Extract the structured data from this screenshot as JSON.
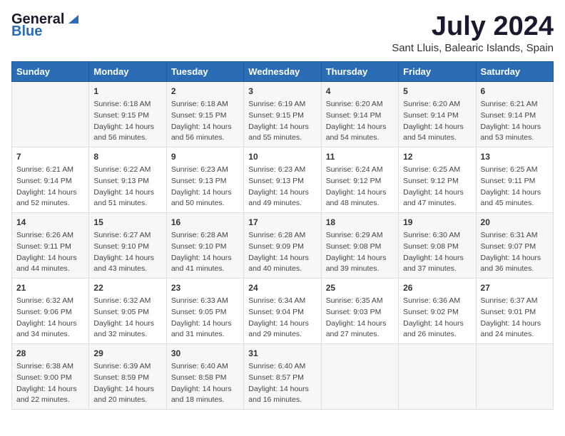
{
  "logo": {
    "general": "General",
    "blue": "Blue"
  },
  "title": "July 2024",
  "subtitle": "Sant Lluis, Balearic Islands, Spain",
  "headers": [
    "Sunday",
    "Monday",
    "Tuesday",
    "Wednesday",
    "Thursday",
    "Friday",
    "Saturday"
  ],
  "weeks": [
    [
      {
        "day": "",
        "content": ""
      },
      {
        "day": "1",
        "content": "Sunrise: 6:18 AM\nSunset: 9:15 PM\nDaylight: 14 hours\nand 56 minutes."
      },
      {
        "day": "2",
        "content": "Sunrise: 6:18 AM\nSunset: 9:15 PM\nDaylight: 14 hours\nand 56 minutes."
      },
      {
        "day": "3",
        "content": "Sunrise: 6:19 AM\nSunset: 9:15 PM\nDaylight: 14 hours\nand 55 minutes."
      },
      {
        "day": "4",
        "content": "Sunrise: 6:20 AM\nSunset: 9:14 PM\nDaylight: 14 hours\nand 54 minutes."
      },
      {
        "day": "5",
        "content": "Sunrise: 6:20 AM\nSunset: 9:14 PM\nDaylight: 14 hours\nand 54 minutes."
      },
      {
        "day": "6",
        "content": "Sunrise: 6:21 AM\nSunset: 9:14 PM\nDaylight: 14 hours\nand 53 minutes."
      }
    ],
    [
      {
        "day": "7",
        "content": "Sunrise: 6:21 AM\nSunset: 9:14 PM\nDaylight: 14 hours\nand 52 minutes."
      },
      {
        "day": "8",
        "content": "Sunrise: 6:22 AM\nSunset: 9:13 PM\nDaylight: 14 hours\nand 51 minutes."
      },
      {
        "day": "9",
        "content": "Sunrise: 6:23 AM\nSunset: 9:13 PM\nDaylight: 14 hours\nand 50 minutes."
      },
      {
        "day": "10",
        "content": "Sunrise: 6:23 AM\nSunset: 9:13 PM\nDaylight: 14 hours\nand 49 minutes."
      },
      {
        "day": "11",
        "content": "Sunrise: 6:24 AM\nSunset: 9:12 PM\nDaylight: 14 hours\nand 48 minutes."
      },
      {
        "day": "12",
        "content": "Sunrise: 6:25 AM\nSunset: 9:12 PM\nDaylight: 14 hours\nand 47 minutes."
      },
      {
        "day": "13",
        "content": "Sunrise: 6:25 AM\nSunset: 9:11 PM\nDaylight: 14 hours\nand 45 minutes."
      }
    ],
    [
      {
        "day": "14",
        "content": "Sunrise: 6:26 AM\nSunset: 9:11 PM\nDaylight: 14 hours\nand 44 minutes."
      },
      {
        "day": "15",
        "content": "Sunrise: 6:27 AM\nSunset: 9:10 PM\nDaylight: 14 hours\nand 43 minutes."
      },
      {
        "day": "16",
        "content": "Sunrise: 6:28 AM\nSunset: 9:10 PM\nDaylight: 14 hours\nand 41 minutes."
      },
      {
        "day": "17",
        "content": "Sunrise: 6:28 AM\nSunset: 9:09 PM\nDaylight: 14 hours\nand 40 minutes."
      },
      {
        "day": "18",
        "content": "Sunrise: 6:29 AM\nSunset: 9:08 PM\nDaylight: 14 hours\nand 39 minutes."
      },
      {
        "day": "19",
        "content": "Sunrise: 6:30 AM\nSunset: 9:08 PM\nDaylight: 14 hours\nand 37 minutes."
      },
      {
        "day": "20",
        "content": "Sunrise: 6:31 AM\nSunset: 9:07 PM\nDaylight: 14 hours\nand 36 minutes."
      }
    ],
    [
      {
        "day": "21",
        "content": "Sunrise: 6:32 AM\nSunset: 9:06 PM\nDaylight: 14 hours\nand 34 minutes."
      },
      {
        "day": "22",
        "content": "Sunrise: 6:32 AM\nSunset: 9:05 PM\nDaylight: 14 hours\nand 32 minutes."
      },
      {
        "day": "23",
        "content": "Sunrise: 6:33 AM\nSunset: 9:05 PM\nDaylight: 14 hours\nand 31 minutes."
      },
      {
        "day": "24",
        "content": "Sunrise: 6:34 AM\nSunset: 9:04 PM\nDaylight: 14 hours\nand 29 minutes."
      },
      {
        "day": "25",
        "content": "Sunrise: 6:35 AM\nSunset: 9:03 PM\nDaylight: 14 hours\nand 27 minutes."
      },
      {
        "day": "26",
        "content": "Sunrise: 6:36 AM\nSunset: 9:02 PM\nDaylight: 14 hours\nand 26 minutes."
      },
      {
        "day": "27",
        "content": "Sunrise: 6:37 AM\nSunset: 9:01 PM\nDaylight: 14 hours\nand 24 minutes."
      }
    ],
    [
      {
        "day": "28",
        "content": "Sunrise: 6:38 AM\nSunset: 9:00 PM\nDaylight: 14 hours\nand 22 minutes."
      },
      {
        "day": "29",
        "content": "Sunrise: 6:39 AM\nSunset: 8:59 PM\nDaylight: 14 hours\nand 20 minutes."
      },
      {
        "day": "30",
        "content": "Sunrise: 6:40 AM\nSunset: 8:58 PM\nDaylight: 14 hours\nand 18 minutes."
      },
      {
        "day": "31",
        "content": "Sunrise: 6:40 AM\nSunset: 8:57 PM\nDaylight: 14 hours\nand 16 minutes."
      },
      {
        "day": "",
        "content": ""
      },
      {
        "day": "",
        "content": ""
      },
      {
        "day": "",
        "content": ""
      }
    ]
  ]
}
